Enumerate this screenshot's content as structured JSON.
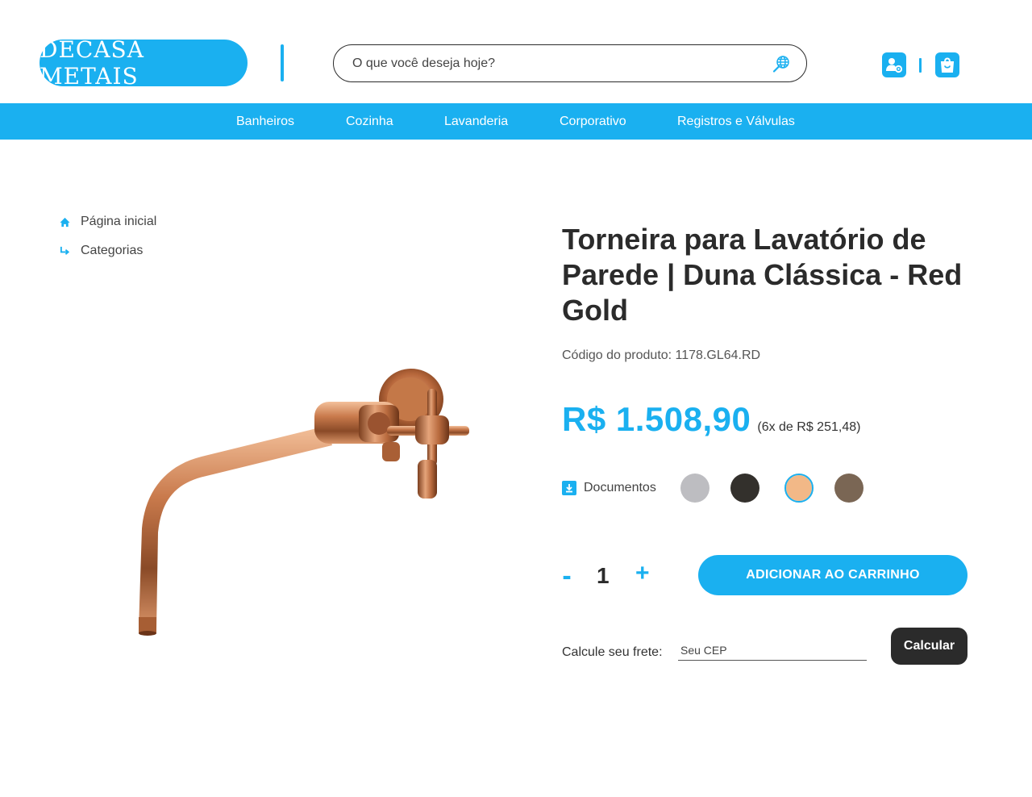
{
  "header": {
    "logo_text": "DECASA METAIS",
    "search_placeholder": "O que você deseja hoje?",
    "search_icon": "globe-search-icon",
    "account_icon": "user-settings-icon",
    "cart_icon": "shopping-bag-icon"
  },
  "nav": {
    "items": [
      {
        "label": "Banheiros"
      },
      {
        "label": "Cozinha"
      },
      {
        "label": "Lavanderia"
      },
      {
        "label": "Corporativo"
      },
      {
        "label": "Registros e Válvulas"
      }
    ]
  },
  "breadcrumb": {
    "items": [
      {
        "label": "Página inicial",
        "icon": "home-icon"
      },
      {
        "label": "Categorias",
        "icon": "arrow-turn-down-right-icon"
      }
    ]
  },
  "product": {
    "title": "Torneira para Lavatório de Parede | Duna Clássica - Red Gold",
    "code": "Código do produto: 1178.GL64.RD",
    "price": "R$ 1.508,90",
    "installments": "(6x de R$ 251,48)",
    "documents_label": "Documentos",
    "documents_icon": "download-icon",
    "image_icon": "faucet-image",
    "swatches": [
      {
        "color": "#bdbdc1",
        "selected": false
      },
      {
        "color": "#33302c",
        "selected": false
      },
      {
        "color": "#f2b887",
        "selected": true
      },
      {
        "color": "#7a6654",
        "selected": false
      }
    ],
    "quantity": {
      "minus": "-",
      "value": "1",
      "plus": "+"
    },
    "add_to_cart": "ADICIONAR AO CARRINHO"
  },
  "shipping": {
    "label": "Calcule seu frete:",
    "cep_placeholder": "Seu CEP",
    "calculate_button": "Calcular"
  },
  "colors": {
    "accent": "#1ab0f0",
    "dark": "#2b2b2b"
  }
}
